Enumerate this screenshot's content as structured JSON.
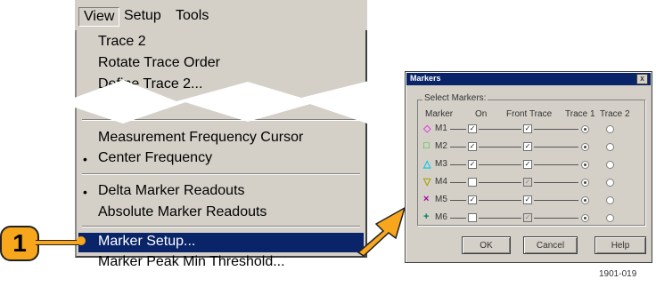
{
  "menubar": {
    "view": "View",
    "setup": "Setup",
    "tools": "Tools"
  },
  "menu": {
    "trace2": "Trace 2",
    "rotate": "Rotate Trace Order",
    "define": "Define Trace 2...",
    "meas_cursor": "Measurement Frequency Cursor",
    "center_freq": "Center Frequency",
    "delta_readouts": "Delta Marker Readouts",
    "abs_readouts": "Absolute Marker Readouts",
    "marker_setup": "Marker Setup...",
    "peak_threshold": "Marker Peak Min Threshold...",
    "bullet": "•"
  },
  "callout": {
    "number": "1",
    "color": "#f8a61c"
  },
  "dialog": {
    "title": "Markers",
    "close": "x",
    "group_label": "Select Markers:",
    "headers": {
      "marker": "Marker",
      "on": "On",
      "front": "Front Trace",
      "trace1": "Trace 1",
      "trace2": "Trace 2"
    },
    "markers": [
      {
        "name": "M1",
        "symbol": "◇",
        "color": "#e040e0",
        "on": true,
        "front": true,
        "trace": 1
      },
      {
        "name": "M2",
        "symbol": "□",
        "color": "#00c000",
        "on": true,
        "front": true,
        "trace": 1
      },
      {
        "name": "M3",
        "symbol": "△",
        "color": "#00c8e8",
        "on": true,
        "front": true,
        "trace": 1
      },
      {
        "name": "M4",
        "symbol": "▽",
        "color": "#a8a000",
        "on": false,
        "front": true,
        "trace": 1
      },
      {
        "name": "M5",
        "symbol": "×",
        "color": "#a000a0",
        "on": true,
        "front": true,
        "trace": 1
      },
      {
        "name": "M6",
        "symbol": "+",
        "color": "#008060",
        "on": false,
        "front": true,
        "trace": 1
      }
    ],
    "check_mark": "✓",
    "buttons": {
      "ok": "OK",
      "cancel": "Cancel",
      "help": "Help"
    }
  },
  "figure_id": "1901-019"
}
